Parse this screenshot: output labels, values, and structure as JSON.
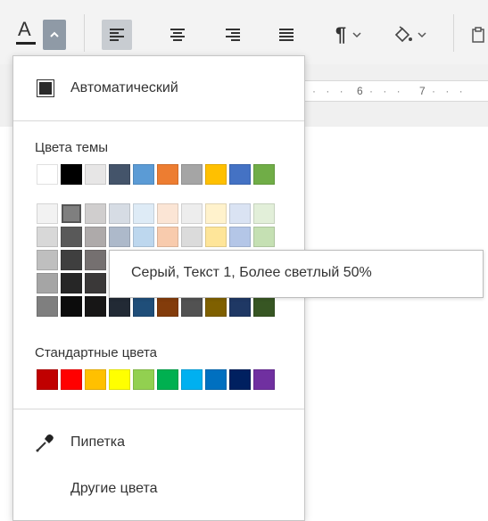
{
  "toolbar": {
    "font_color_glyph": "A",
    "paragraph_glyph": "¶",
    "colors": {
      "font_color_bar": "#222222",
      "active_bg": "#c8ccd1"
    }
  },
  "ruler": {
    "marks": [
      "6",
      "7"
    ]
  },
  "dropdown": {
    "automatic_label": "Автоматический",
    "theme_section_label": "Цвета темы",
    "theme_colors": [
      "#ffffff",
      "#000000",
      "#e7e6e6",
      "#44546a",
      "#5b9bd5",
      "#ed7d31",
      "#a5a5a5",
      "#ffc000",
      "#4472c4",
      "#70ad47"
    ],
    "shade_rows": [
      [
        "#f2f2f2",
        "#7f7f7f",
        "#d0cece",
        "#d6dce4",
        "#deebf6",
        "#fbe5d5",
        "#ededed",
        "#fff2cc",
        "#dae3f3",
        "#e2efd9"
      ],
      [
        "#d8d8d8",
        "#595959",
        "#aeaaaa",
        "#adb9ca",
        "#bdd7ee",
        "#f8cbad",
        "#dbdbdb",
        "#fee599",
        "#b4c6e7",
        "#c5e0b3"
      ],
      [
        "#bfbfbf",
        "#3f3f3f",
        "#757070",
        "#8496b0",
        "#9cc3e5",
        "#f4b183",
        "#c9c9c9",
        "#ffd966",
        "#8eaadb",
        "#a8d08d"
      ],
      [
        "#a5a5a5",
        "#262626",
        "#3a3838",
        "#323f4f",
        "#2e75b5",
        "#c55a11",
        "#7b7b7b",
        "#bf9000",
        "#2f5496",
        "#538135"
      ],
      [
        "#7f7f7f",
        "#0c0c0c",
        "#171616",
        "#222a35",
        "#1f4e79",
        "#833c0b",
        "#525252",
        "#7f6000",
        "#1f3864",
        "#375623"
      ]
    ],
    "standard_section_label": "Стандартные цвета",
    "standard_colors": [
      "#c00000",
      "#ff0000",
      "#ffc000",
      "#ffff00",
      "#92d050",
      "#00b050",
      "#00b0f0",
      "#0070c0",
      "#002060",
      "#7030a0"
    ],
    "eyedropper_label": "Пипетка",
    "more_colors_label": "Другие цвета"
  },
  "tooltip": {
    "text": "Серый, Текст 1, Более светлый 50%"
  }
}
